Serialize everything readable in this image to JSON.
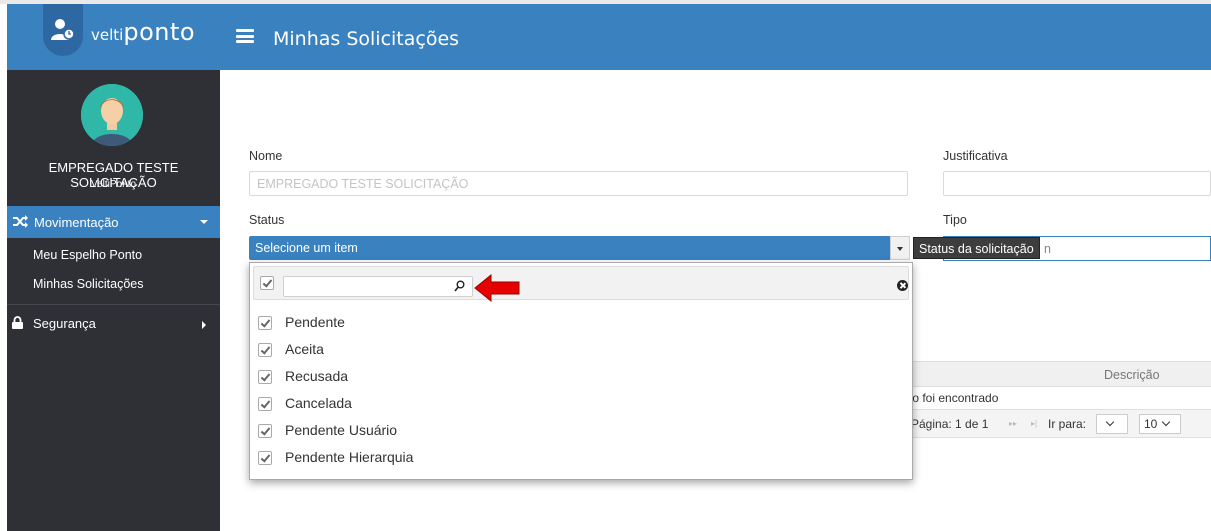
{
  "brand": {
    "prefix": "velti",
    "name": "ponto"
  },
  "colors": {
    "primary": "#3a81bf",
    "sidebar": "#2e3036",
    "tooltip": "#3d3d3d",
    "arrow": "#e60000"
  },
  "user": {
    "name": "EMPREGADO TESTE SOLICITAÇÃO",
    "company": "VeltiPonto"
  },
  "nav": {
    "movimentacao": "Movimentação",
    "items": [
      "Meu Espelho Ponto",
      "Minhas Solicitações"
    ],
    "seguranca": "Segurança"
  },
  "header": {
    "title": "Minhas Solicitações"
  },
  "form": {
    "nome_label": "Nome",
    "nome_value": "EMPREGADO TESTE SOLICITAÇÃO",
    "justificativa_label": "Justificativa",
    "justificativa_value": "",
    "status_label": "Status",
    "status_placeholder": "Selecione um item",
    "tipo_label": "Tipo",
    "tipo_partial": "n",
    "tooltip": "Status da solicitação"
  },
  "dropdown": {
    "search_value": "",
    "options": [
      "Pendente",
      "Aceita",
      "Recusada",
      "Cancelada",
      "Pendente Usuário",
      "Pendente Hierarquia"
    ]
  },
  "grid": {
    "column": "Descrição",
    "empty_text": "tro foi encontrado",
    "page_text": "Página: 1 de 1",
    "goto_label": "Ir para:",
    "page_size": "10"
  }
}
